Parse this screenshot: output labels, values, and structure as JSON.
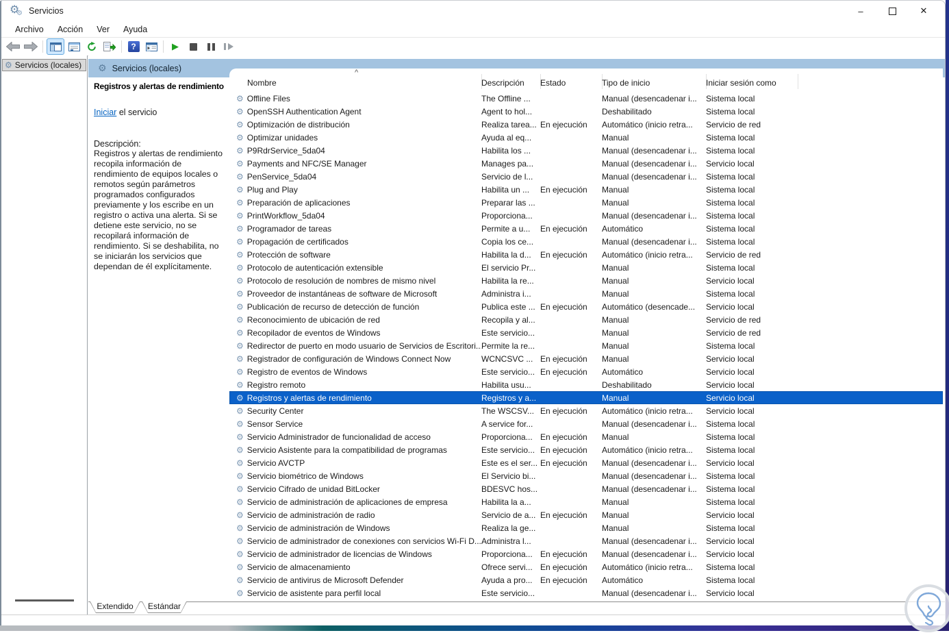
{
  "window": {
    "title": "Servicios"
  },
  "menu": [
    "Archivo",
    "Acción",
    "Ver",
    "Ayuda"
  ],
  "toolbar": [
    "back-icon",
    "forward-icon",
    "sep",
    "show-console-tree-icon",
    "properties-icon",
    "refresh-icon",
    "export-list-icon",
    "sep",
    "help-icon",
    "extended-view-icon",
    "sep",
    "start-service-icon",
    "stop-service-icon",
    "pause-service-icon",
    "restart-service-icon"
  ],
  "tree": {
    "selected_item": "Servicios (locales)"
  },
  "pane": {
    "header": "Servicios (locales)"
  },
  "details": {
    "title": "Registros y alertas de rendimiento",
    "action_link": "Iniciar",
    "action_rest": " el servicio",
    "description_label": "Descripción:",
    "description": "Registros y alertas de rendimiento recopila información de rendimiento de equipos locales o remotos según parámetros programados configurados previamente y los escribe en un registro o activa una alerta. Si se detiene este servicio, no se recopilará información de rendimiento. Si se deshabilita, no se iniciarán los servicios que dependan de él explícitamente."
  },
  "table": {
    "columns": [
      "Nombre",
      "Descripción",
      "Estado",
      "Tipo de inicio",
      "Iniciar sesión como"
    ],
    "rows": [
      {
        "name": "Offline Files",
        "desc": "The Offline ...",
        "estado": "",
        "tipo": "Manual (desencadenar i...",
        "logon": "Sistema local",
        "selected": false
      },
      {
        "name": "OpenSSH Authentication Agent",
        "desc": "Agent to hol...",
        "estado": "",
        "tipo": "Deshabilitado",
        "logon": "Sistema local",
        "selected": false
      },
      {
        "name": "Optimización de distribución",
        "desc": "Realiza tarea...",
        "estado": "En ejecución",
        "tipo": "Automático (inicio retra...",
        "logon": "Servicio de red",
        "selected": false
      },
      {
        "name": "Optimizar unidades",
        "desc": "Ayuda al eq...",
        "estado": "",
        "tipo": "Manual",
        "logon": "Sistema local",
        "selected": false
      },
      {
        "name": "P9RdrService_5da04",
        "desc": "Habilita los ...",
        "estado": "",
        "tipo": "Manual (desencadenar i...",
        "logon": "Sistema local",
        "selected": false
      },
      {
        "name": "Payments and NFC/SE Manager",
        "desc": "Manages pa...",
        "estado": "",
        "tipo": "Manual (desencadenar i...",
        "logon": "Servicio local",
        "selected": false
      },
      {
        "name": "PenService_5da04",
        "desc": "Servicio de l...",
        "estado": "",
        "tipo": "Manual (desencadenar i...",
        "logon": "Sistema local",
        "selected": false
      },
      {
        "name": "Plug and Play",
        "desc": "Habilita un ...",
        "estado": "En ejecución",
        "tipo": "Manual",
        "logon": "Sistema local",
        "selected": false
      },
      {
        "name": "Preparación de aplicaciones",
        "desc": "Preparar las ...",
        "estado": "",
        "tipo": "Manual",
        "logon": "Sistema local",
        "selected": false
      },
      {
        "name": "PrintWorkflow_5da04",
        "desc": "Proporciona...",
        "estado": "",
        "tipo": "Manual (desencadenar i...",
        "logon": "Sistema local",
        "selected": false
      },
      {
        "name": "Programador de tareas",
        "desc": "Permite a u...",
        "estado": "En ejecución",
        "tipo": "Automático",
        "logon": "Sistema local",
        "selected": false
      },
      {
        "name": "Propagación de certificados",
        "desc": "Copia los ce...",
        "estado": "",
        "tipo": "Manual (desencadenar i...",
        "logon": "Sistema local",
        "selected": false
      },
      {
        "name": "Protección de software",
        "desc": "Habilita la d...",
        "estado": "En ejecución",
        "tipo": "Automático (inicio retra...",
        "logon": "Servicio de red",
        "selected": false
      },
      {
        "name": "Protocolo de autenticación extensible",
        "desc": "El servicio Pr...",
        "estado": "",
        "tipo": "Manual",
        "logon": "Sistema local",
        "selected": false
      },
      {
        "name": "Protocolo de resolución de nombres de mismo nivel",
        "desc": "Habilita la re...",
        "estado": "",
        "tipo": "Manual",
        "logon": "Servicio local",
        "selected": false
      },
      {
        "name": "Proveedor de instantáneas de software de Microsoft",
        "desc": "Administra i...",
        "estado": "",
        "tipo": "Manual",
        "logon": "Sistema local",
        "selected": false
      },
      {
        "name": "Publicación de recurso de detección de función",
        "desc": "Publica este ...",
        "estado": "En ejecución",
        "tipo": "Automático (desencade...",
        "logon": "Servicio local",
        "selected": false
      },
      {
        "name": "Reconocimiento de ubicación de red",
        "desc": "Recopila y al...",
        "estado": "",
        "tipo": "Manual",
        "logon": "Servicio de red",
        "selected": false
      },
      {
        "name": "Recopilador de eventos de Windows",
        "desc": "Este servicio...",
        "estado": "",
        "tipo": "Manual",
        "logon": "Servicio de red",
        "selected": false
      },
      {
        "name": "Redirector de puerto en modo usuario de Servicios de Escritori...",
        "desc": "Permite la re...",
        "estado": "",
        "tipo": "Manual",
        "logon": "Sistema local",
        "selected": false
      },
      {
        "name": "Registrador de configuración de Windows Connect Now",
        "desc": "WCNCSVC ...",
        "estado": "En ejecución",
        "tipo": "Manual",
        "logon": "Servicio local",
        "selected": false
      },
      {
        "name": "Registro de eventos de Windows",
        "desc": "Este servicio...",
        "estado": "En ejecución",
        "tipo": "Automático",
        "logon": "Servicio local",
        "selected": false
      },
      {
        "name": "Registro remoto",
        "desc": "Habilita usu...",
        "estado": "",
        "tipo": "Deshabilitado",
        "logon": "Servicio local",
        "selected": false
      },
      {
        "name": "Registros y alertas de rendimiento",
        "desc": "Registros y a...",
        "estado": "",
        "tipo": "Manual",
        "logon": "Servicio local",
        "selected": true
      },
      {
        "name": "Security Center",
        "desc": "The WSCSV...",
        "estado": "En ejecución",
        "tipo": "Automático (inicio retra...",
        "logon": "Servicio local",
        "selected": false
      },
      {
        "name": "Sensor Service",
        "desc": "A service for...",
        "estado": "",
        "tipo": "Manual (desencadenar i...",
        "logon": "Sistema local",
        "selected": false
      },
      {
        "name": "Servicio Administrador de funcionalidad de acceso",
        "desc": "Proporciona...",
        "estado": "En ejecución",
        "tipo": "Manual",
        "logon": "Sistema local",
        "selected": false
      },
      {
        "name": "Servicio Asistente para la compatibilidad de programas",
        "desc": "Este servicio...",
        "estado": "En ejecución",
        "tipo": "Automático (inicio retra...",
        "logon": "Sistema local",
        "selected": false
      },
      {
        "name": "Servicio AVCTP",
        "desc": "Este es el ser...",
        "estado": "En ejecución",
        "tipo": "Manual (desencadenar i...",
        "logon": "Servicio local",
        "selected": false
      },
      {
        "name": "Servicio biométrico de Windows",
        "desc": "El Servicio bi...",
        "estado": "",
        "tipo": "Manual (desencadenar i...",
        "logon": "Sistema local",
        "selected": false
      },
      {
        "name": "Servicio Cifrado de unidad BitLocker",
        "desc": "BDESVC hos...",
        "estado": "",
        "tipo": "Manual (desencadenar i...",
        "logon": "Sistema local",
        "selected": false
      },
      {
        "name": "Servicio de administración de aplicaciones de empresa",
        "desc": "Habilita la a...",
        "estado": "",
        "tipo": "Manual",
        "logon": "Sistema local",
        "selected": false
      },
      {
        "name": "Servicio de administración de radio",
        "desc": "Servicio de a...",
        "estado": "En ejecución",
        "tipo": "Manual",
        "logon": "Servicio local",
        "selected": false
      },
      {
        "name": "Servicio de administración de Windows",
        "desc": "Realiza la ge...",
        "estado": "",
        "tipo": "Manual",
        "logon": "Sistema local",
        "selected": false
      },
      {
        "name": "Servicio de administrador de conexiones con servicios Wi-Fi D...",
        "desc": "Administra l...",
        "estado": "",
        "tipo": "Manual (desencadenar i...",
        "logon": "Servicio local",
        "selected": false
      },
      {
        "name": "Servicio de administrador de licencias de Windows",
        "desc": "Proporciona...",
        "estado": "En ejecución",
        "tipo": "Manual (desencadenar i...",
        "logon": "Servicio local",
        "selected": false
      },
      {
        "name": "Servicio de almacenamiento",
        "desc": "Ofrece servi...",
        "estado": "En ejecución",
        "tipo": "Automático (inicio retra...",
        "logon": "Sistema local",
        "selected": false
      },
      {
        "name": "Servicio de antivirus de Microsoft Defender",
        "desc": "Ayuda a pro...",
        "estado": "En ejecución",
        "tipo": "Automático",
        "logon": "Sistema local",
        "selected": false
      },
      {
        "name": "Servicio de asistente para perfil local",
        "desc": "Este servicio...",
        "estado": "",
        "tipo": "Manual (desencadenar i...",
        "logon": "Servicio local",
        "selected": false
      }
    ]
  },
  "tabs": [
    "Extendido",
    "Estándar"
  ],
  "window_controls": {
    "minimize": "–",
    "close": "✕"
  },
  "colors": {
    "selection": "#0b61c9",
    "pane_band": "#a3c3e0",
    "link": "#0563c1",
    "start_glyph_green": "#1fa11f"
  }
}
